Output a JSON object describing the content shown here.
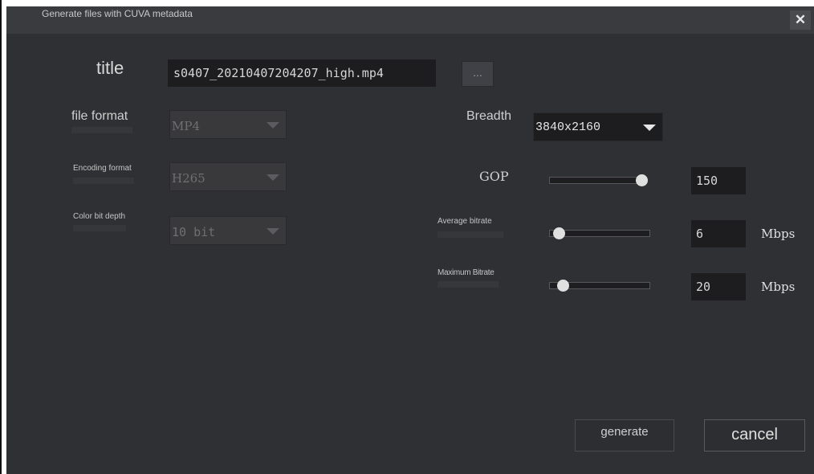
{
  "window": {
    "title": "Generate files with CUVA metadata",
    "close_glyph": "✕"
  },
  "title_field": {
    "label": "title",
    "value": "s0407_20210407204207_high.mp4",
    "browse_label": "..."
  },
  "left": {
    "file_format": {
      "label": "file format",
      "value": "MP4"
    },
    "encoding_format": {
      "label": "Encoding format",
      "value": "H265"
    },
    "color_bit_depth": {
      "label": "Color bit depth",
      "value": "10 bit"
    }
  },
  "right": {
    "breadth": {
      "label": "Breadth",
      "value": "3840x2160"
    },
    "gop": {
      "label": "GOP",
      "value": "150",
      "slider_level": 1.0
    },
    "average_bitrate": {
      "label": "Average bitrate",
      "value": "6",
      "unit": "Mbps",
      "slider_level": 0.05
    },
    "maximum_bitrate": {
      "label": "Maximum Bitrate",
      "value": "20",
      "unit": "Mbps",
      "slider_level": 0.1
    }
  },
  "buttons": {
    "generate": "generate",
    "cancel": "cancel"
  },
  "icons": {
    "close": "close-icon",
    "dropdown": "chevron-down-icon"
  }
}
